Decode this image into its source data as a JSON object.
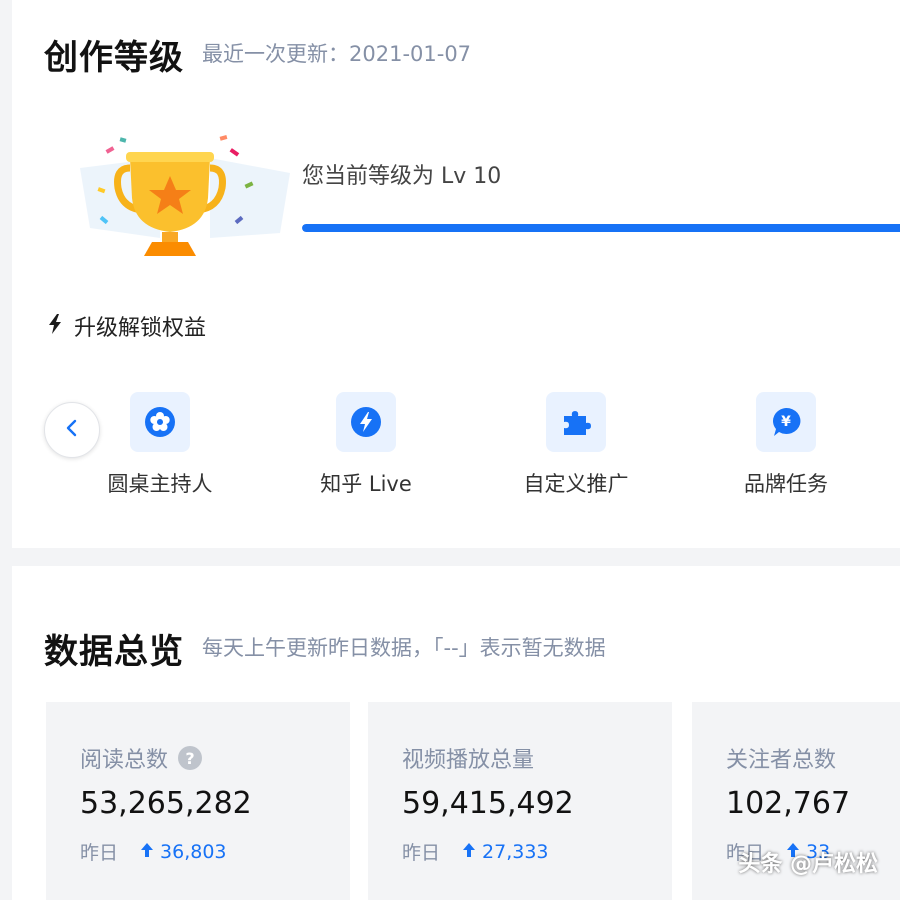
{
  "level_section": {
    "title": "创作等级",
    "updated": "最近一次更新：2021-01-07",
    "current_level": "您当前等级为 Lv 10",
    "progress": 1.0,
    "unlock_title": "升级解锁权益",
    "benefits": [
      {
        "label": "圆桌主持人",
        "icon": "flower-icon"
      },
      {
        "label": "知乎 Live",
        "icon": "lightning-icon"
      },
      {
        "label": "自定义推广",
        "icon": "puzzle-icon"
      },
      {
        "label": "品牌任务",
        "icon": "yen-chat-icon"
      }
    ]
  },
  "data_section": {
    "title": "数据总览",
    "subtitle": "每天上午更新昨日数据，「--」表示暂无数据",
    "stats": [
      {
        "label": "阅读总数",
        "value": "53,265,282",
        "yesterday_label": "昨日",
        "delta": "36,803"
      },
      {
        "label": "视频播放总量",
        "value": "59,415,492",
        "yesterday_label": "昨日",
        "delta": "27,333"
      },
      {
        "label": "关注者总数",
        "value": "102,767",
        "yesterday_label": "昨日",
        "delta": "33"
      }
    ]
  },
  "watermark": "头条 @卢松松",
  "colors": {
    "accent": "#1772f6",
    "icon_bg": "#e9f2ff",
    "muted": "#8590a6"
  }
}
